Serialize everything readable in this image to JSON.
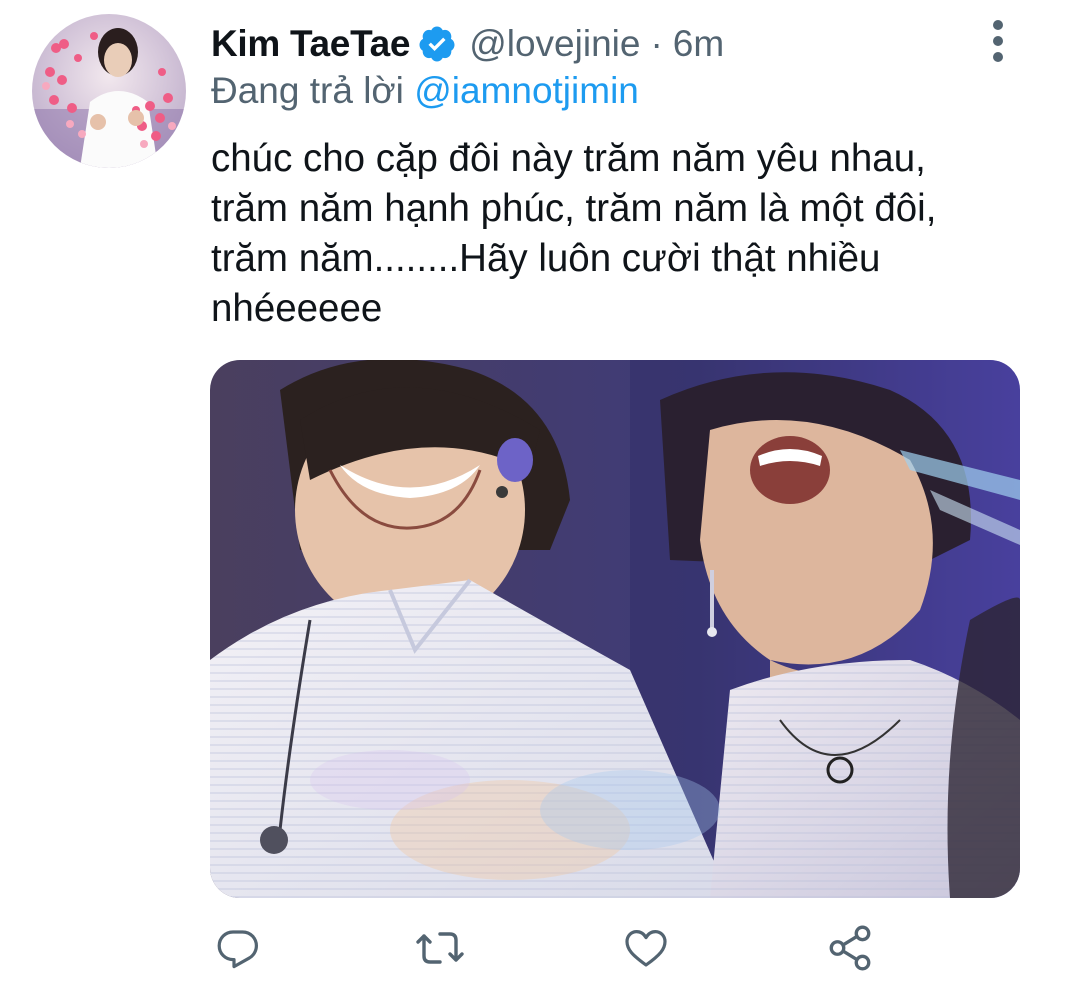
{
  "tweet": {
    "author": {
      "display_name": "Kim TaeTae",
      "verified_icon": "verified-badge-icon",
      "handle": "@lovejinie",
      "separator": "·",
      "timestamp": "6m"
    },
    "reply_to": {
      "prefix": "Đang trả lời",
      "mention": "@iamnotjimin"
    },
    "text_lines": [
      "chúc cho cặp đôi này trăm năm yêu nhau,",
      "trăm năm hạnh phúc, trăm năm là một đôi,",
      "trăm năm........Hãy luôn cười thật nhiều",
      "nhéeeeee"
    ],
    "actions": {
      "reply_icon": "reply-icon",
      "retweet_icon": "retweet-icon",
      "like_icon": "heart-icon",
      "share_icon": "share-icon",
      "more_icon": "more-vertical-icon"
    }
  },
  "colors": {
    "text_primary": "#0f1419",
    "text_secondary": "#536471",
    "accent": "#1d9bf0",
    "icon_gray": "#536471"
  }
}
